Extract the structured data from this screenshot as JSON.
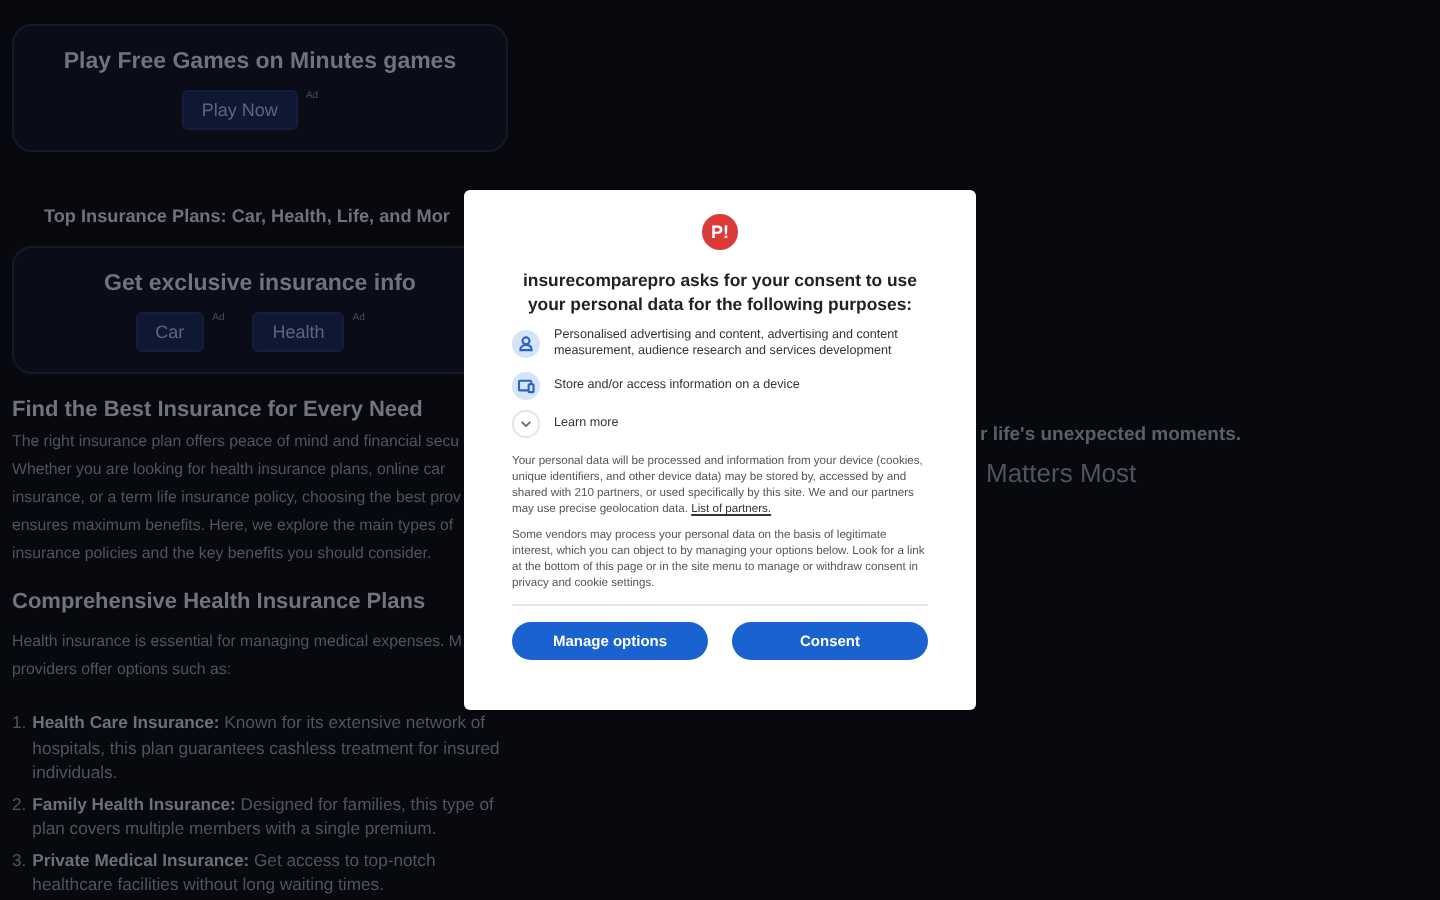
{
  "promo_card": {
    "title": "Play Free Games on Minutes games",
    "button": "Play Now",
    "ad_mark": "Ad"
  },
  "plans_heading": "Top Insurance Plans: Car, Health, Life, and Mor",
  "info_card": {
    "title": "Get exclusive insurance info",
    "buttons": [
      {
        "label": "Car",
        "ad_mark": "Ad"
      },
      {
        "label": "Health",
        "ad_mark": "Ad"
      }
    ]
  },
  "article": {
    "heading": "Find the Best Insurance for Every Need",
    "intro_lines": [
      "The right insurance plan offers peace of mind and financial secu",
      "Whether you are looking for health insurance plans, online car",
      "insurance, or a term life insurance policy, choosing the best prov",
      "ensures maximum benefits. Here, we explore the main types of",
      "insurance policies and the key benefits you should consider."
    ],
    "section_heading": "Comprehensive Health Insurance Plans",
    "section_lines": [
      "Health insurance is essential for managing medical expenses. M",
      "providers offer options such as:"
    ],
    "list": [
      {
        "number": "1.",
        "text": "**Health Care Insurance:** Known for its extensive network of hospitals, this plan guarantees cashless treatment for insured individuals."
      },
      {
        "number": "2.",
        "text": "**Family Health Insurance:** Designed for families, this type of plan covers multiple members with a single premium."
      },
      {
        "number": "3.",
        "text": "**Private Medical Insurance:** Get access to top-notch healthcare facilities without long waiting times."
      }
    ]
  },
  "right_column": {
    "tagline": "r life's unexpected moments.",
    "heading": "Matters Most"
  },
  "consent_dialog": {
    "logo": "P!",
    "title": "insurecomparepro asks for your consent to use your personal data for the following purposes:",
    "purposes": [
      {
        "kind": "person",
        "text": "Personalised advertising and content, advertising and content measurement, audience research and services development"
      },
      {
        "kind": "device",
        "text": "Store and/or access information on a device"
      }
    ],
    "learn_more": {
      "label": "Learn more",
      "expanded": false
    },
    "body": "Your personal data will be processed and information from your device (cookies, unique identifiers, and other device data) may be stored by, accessed by and shared with 210 partners, or used specifically by this site. We and our partners may use precise geolocation data.",
    "partners_link": "List of partners.",
    "body_2": "Some vendors may process your personal data on the basis of legitimate interest, which you can object to by managing your options below. Look for a link at the bottom of this page or in the site menu to manage or withdraw consent in privacy and cookie settings.",
    "buttons": [
      "Manage options",
      "Consent"
    ]
  }
}
